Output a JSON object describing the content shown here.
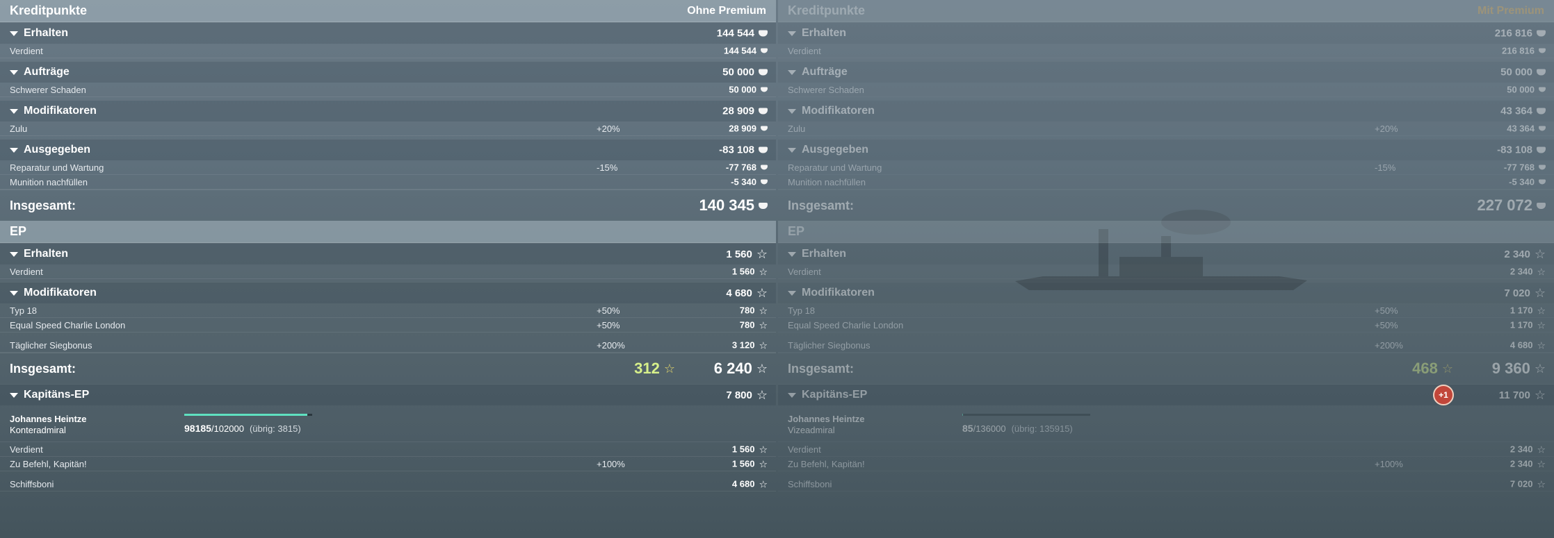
{
  "left": {
    "credits": {
      "title": "Kreditpunkte",
      "account": "Ohne Premium",
      "earned": {
        "label": "Erhalten",
        "value": "144 544",
        "rows": [
          {
            "label": "Verdient",
            "pct": "",
            "value": "144 544"
          }
        ]
      },
      "missions": {
        "label": "Aufträge",
        "value": "50 000",
        "rows": [
          {
            "label": "Schwerer Schaden",
            "pct": "",
            "value": "50 000"
          }
        ]
      },
      "modifiers": {
        "label": "Modifikatoren",
        "value": "28 909",
        "rows": [
          {
            "label": "Zulu",
            "pct": "+20%",
            "value": "28 909"
          }
        ]
      },
      "spent": {
        "label": "Ausgegeben",
        "value": "-83 108",
        "rows": [
          {
            "label": "Reparatur und Wartung",
            "pct": "-15%",
            "value": "-77 768"
          },
          {
            "label": "Munition nachfüllen",
            "pct": "",
            "value": "-5 340"
          }
        ]
      },
      "total": {
        "label": "Insgesamt:",
        "value": "140 345"
      }
    },
    "xp": {
      "title": "EP",
      "earned": {
        "label": "Erhalten",
        "value": "1 560",
        "rows": [
          {
            "label": "Verdient",
            "pct": "",
            "value": "1 560"
          }
        ]
      },
      "modifiers": {
        "label": "Modifikatoren",
        "value": "4 680",
        "rows": [
          {
            "label": "Typ 18",
            "pct": "+50%",
            "value": "780"
          },
          {
            "label": "Equal Speed Charlie London",
            "pct": "+50%",
            "value": "780"
          },
          {
            "label": "Täglicher Siegbonus",
            "pct": "+200%",
            "value": "3 120"
          }
        ]
      },
      "total": {
        "label": "Insgesamt:",
        "bonus": "312",
        "value": "6 240"
      }
    },
    "captain": {
      "label": "Kapitäns-EP",
      "value": "7 800",
      "name": "Johannes Heintze",
      "rank": "Konteradmiral",
      "progress_current": "98185",
      "progress_max": "/102000",
      "progress_rest": "(übrig: 3815)",
      "progress_fraction": 0.9626,
      "rows": [
        {
          "label": "Verdient",
          "pct": "",
          "value": "1 560"
        },
        {
          "label": "Zu Befehl, Kapitän!",
          "pct": "+100%",
          "value": "1 560"
        },
        {
          "label": "Schiffsboni",
          "pct": "",
          "value": "4 680"
        }
      ]
    }
  },
  "right": {
    "credits": {
      "title": "Kreditpunkte",
      "account": "Mit Premium",
      "earned": {
        "label": "Erhalten",
        "value": "216 816",
        "rows": [
          {
            "label": "Verdient",
            "pct": "",
            "value": "216 816"
          }
        ]
      },
      "missions": {
        "label": "Aufträge",
        "value": "50 000",
        "rows": [
          {
            "label": "Schwerer Schaden",
            "pct": "",
            "value": "50 000"
          }
        ]
      },
      "modifiers": {
        "label": "Modifikatoren",
        "value": "43 364",
        "rows": [
          {
            "label": "Zulu",
            "pct": "+20%",
            "value": "43 364"
          }
        ]
      },
      "spent": {
        "label": "Ausgegeben",
        "value": "-83 108",
        "rows": [
          {
            "label": "Reparatur und Wartung",
            "pct": "-15%",
            "value": "-77 768"
          },
          {
            "label": "Munition nachfüllen",
            "pct": "",
            "value": "-5 340"
          }
        ]
      },
      "total": {
        "label": "Insgesamt:",
        "value": "227 072"
      }
    },
    "xp": {
      "title": "EP",
      "earned": {
        "label": "Erhalten",
        "value": "2 340",
        "rows": [
          {
            "label": "Verdient",
            "pct": "",
            "value": "2 340"
          }
        ]
      },
      "modifiers": {
        "label": "Modifikatoren",
        "value": "7 020",
        "rows": [
          {
            "label": "Typ 18",
            "pct": "+50%",
            "value": "1 170"
          },
          {
            "label": "Equal Speed Charlie London",
            "pct": "+50%",
            "value": "1 170"
          },
          {
            "label": "Täglicher Siegbonus",
            "pct": "+200%",
            "value": "4 680"
          }
        ]
      },
      "total": {
        "label": "Insgesamt:",
        "bonus": "468",
        "value": "9 360"
      }
    },
    "captain": {
      "label": "Kapitäns-EP",
      "value": "11 700",
      "level_badge": "+1",
      "name": "Johannes Heintze",
      "rank": "Vizeadmiral",
      "progress_current": "85",
      "progress_max": "/136000",
      "progress_rest": "(übrig: 135915)",
      "progress_fraction": 0.0006,
      "rows": [
        {
          "label": "Verdient",
          "pct": "",
          "value": "2 340"
        },
        {
          "label": "Zu Befehl, Kapitän!",
          "pct": "+100%",
          "value": "2 340"
        },
        {
          "label": "Schiffsboni",
          "pct": "",
          "value": "7 020"
        }
      ]
    }
  }
}
